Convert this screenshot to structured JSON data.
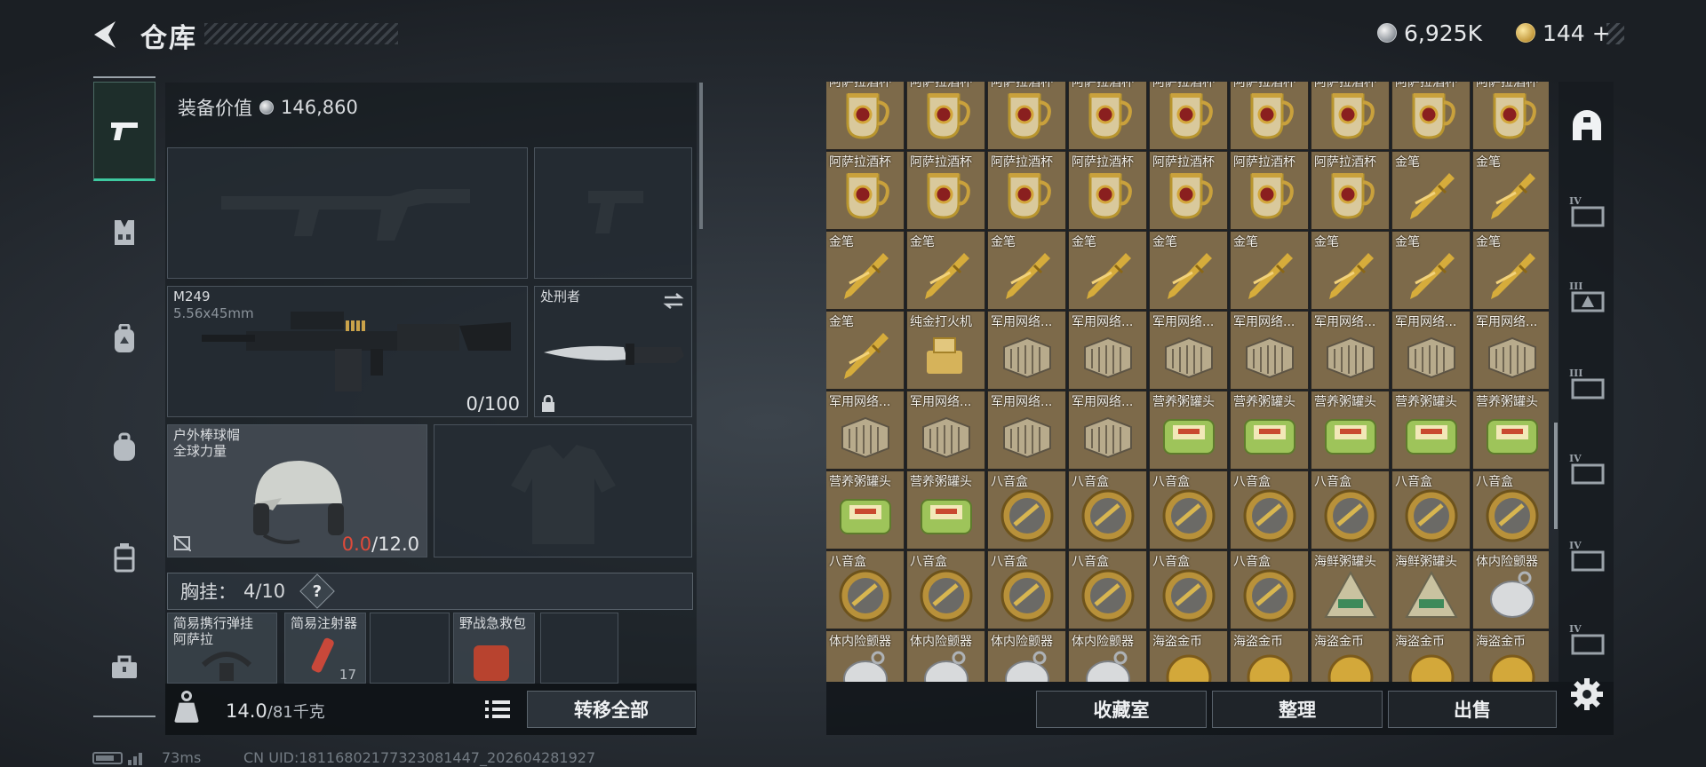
{
  "header": {
    "title": "仓库",
    "currency_silver": "6,925K",
    "currency_gold": "144",
    "currency_add": "+"
  },
  "rail": [
    "pistol-icon",
    "vest-icon",
    "backpack-icon",
    "bag-icon",
    "case-icon",
    "toolbox-icon"
  ],
  "equipment": {
    "value_label": "装备价值",
    "value": "146,860",
    "primary": {
      "name": "M249",
      "caliber": "5.56x45mm",
      "ammo": "0/100"
    },
    "melee": {
      "name": "处刑者"
    },
    "helmet": {
      "name": "户外棒球帽",
      "sub": "全球力量",
      "durability_current": "0.0",
      "durability_max": "/12.0"
    },
    "chest": {
      "label": "胸挂：",
      "count": "4/10",
      "help": "?"
    },
    "pouch_items": [
      {
        "name": "简易携行弹挂",
        "sub": "阿萨拉"
      },
      {
        "name": "简易注射器",
        "sub": "17"
      },
      {
        "name": "",
        "sub": ""
      },
      {
        "name": "野战急救包",
        "sub": ""
      },
      {
        "name": "",
        "sub": ""
      }
    ],
    "weight_value": "14.0",
    "weight_max": "/81千克",
    "transfer_all": "转移全部"
  },
  "status": {
    "ping": "73ms",
    "uid": "CN UID:18116802177323081447_202604281927"
  },
  "storage": {
    "rows": [
      [
        "阿萨拉酒杯",
        "阿萨拉酒杯",
        "阿萨拉酒杯",
        "阿萨拉酒杯",
        "阿萨拉酒杯",
        "阿萨拉酒杯",
        "阿萨拉酒杯",
        "阿萨拉酒杯",
        "阿萨拉酒杯"
      ],
      [
        "阿萨拉酒杯",
        "阿萨拉酒杯",
        "阿萨拉酒杯",
        "阿萨拉酒杯",
        "阿萨拉酒杯",
        "阿萨拉酒杯",
        "阿萨拉酒杯",
        "金笔",
        "金笔"
      ],
      [
        "金笔",
        "金笔",
        "金笔",
        "金笔",
        "金笔",
        "金笔",
        "金笔",
        "金笔",
        "金笔"
      ],
      [
        "金笔",
        "纯金打火机",
        "军用网络...",
        "军用网络...",
        "军用网络...",
        "军用网络...",
        "军用网络...",
        "军用网络...",
        "军用网络..."
      ],
      [
        "军用网络...",
        "军用网络...",
        "军用网络...",
        "军用网络...",
        "营养粥罐头",
        "营养粥罐头",
        "营养粥罐头",
        "营养粥罐头",
        "营养粥罐头"
      ],
      [
        "营养粥罐头",
        "营养粥罐头",
        "八音盒",
        "八音盒",
        "八音盒",
        "八音盒",
        "八音盒",
        "八音盒",
        "八音盒"
      ],
      [
        "八音盒",
        "八音盒",
        "八音盒",
        "八音盒",
        "八音盒",
        "八音盒",
        "海鲜粥罐头",
        "海鲜粥罐头",
        "体内险颤器"
      ],
      [
        "体内险颤器",
        "体内险颤器",
        "体内险颤器",
        "体内险颤器",
        "海盗金币",
        "海盗金币",
        "海盗金币",
        "海盗金币",
        "海盗金币"
      ]
    ],
    "buttons": {
      "collection": "收藏室",
      "organize": "整理",
      "sell": "出售"
    }
  },
  "right_rail": [
    "safehouse-icon",
    "IV",
    "III",
    "III",
    "IV",
    "IV",
    "IV"
  ],
  "colors": {
    "accent": "#3ec9a0",
    "cell_bg": "#7d6a4a",
    "durability_red": "#e04a3a"
  }
}
